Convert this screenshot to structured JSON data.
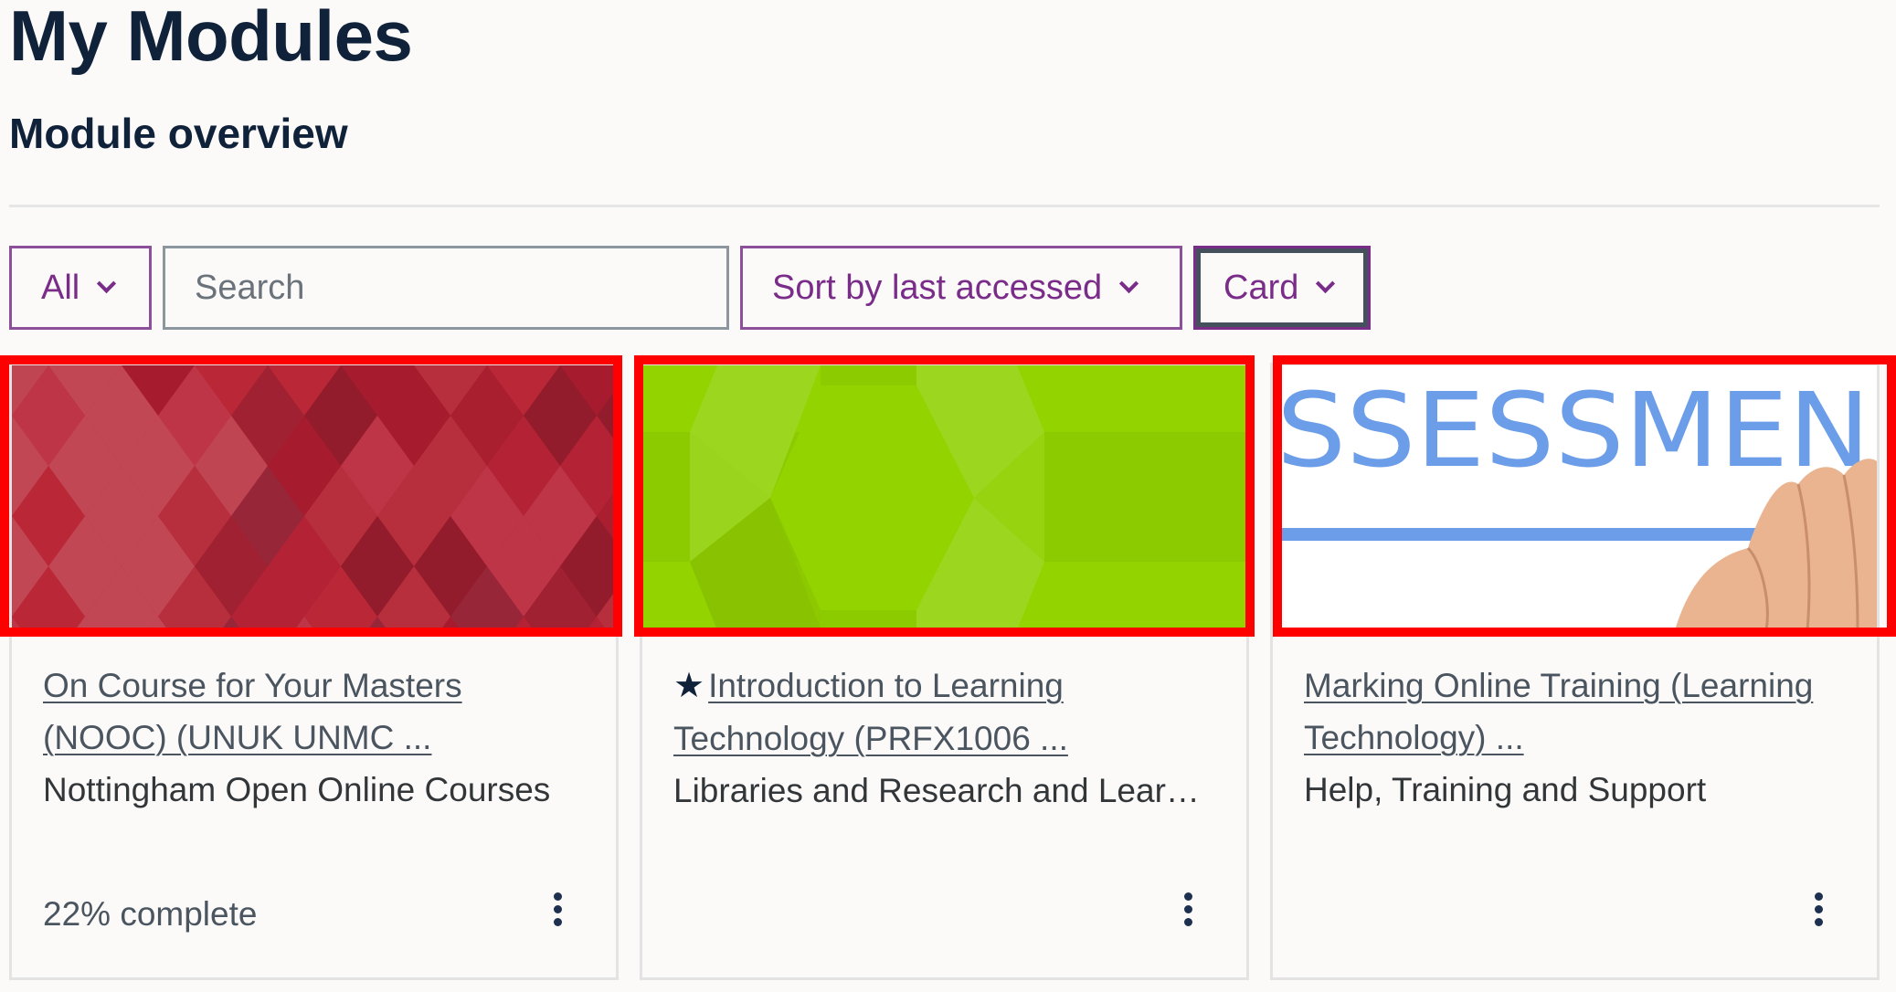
{
  "header": {
    "page_title": "My Modules",
    "section_title": "Module overview"
  },
  "controls": {
    "filter_label": "All",
    "search_placeholder": "Search",
    "search_value": "",
    "sort_label": "Sort by last accessed",
    "view_label": "Card"
  },
  "cards": [
    {
      "title": "On Course for Your Masters (NOOC) (UNUK UNMC ...",
      "category": "Nottingham Open Online Courses",
      "starred": false,
      "progress_text": "22% complete",
      "progress_percent": 22,
      "image": "red-diamond-pattern",
      "menu_icon": "three-dots-vertical-icon"
    },
    {
      "title": "Introduction to Learning Technology (PRFX1006 ...",
      "category": "Libraries and Research and Learning Resources",
      "starred": true,
      "star_icon": "star-icon",
      "progress_text": "",
      "image": "green-hexagon-pattern",
      "menu_icon": "three-dots-vertical-icon"
    },
    {
      "title": "Marking Online Training (Learning Technology) ...",
      "category": "Help, Training and Support",
      "starred": false,
      "progress_text": "",
      "image": "assessment-handwriting",
      "image_text": "SSESSMEN",
      "menu_icon": "three-dots-vertical-icon"
    }
  ],
  "colors": {
    "heading": "#0f223a",
    "accent_purple": "#7a2c89",
    "highlight_red": "#ff0000",
    "card_border": "#e3e3e3",
    "background": "#fbfaf9"
  }
}
